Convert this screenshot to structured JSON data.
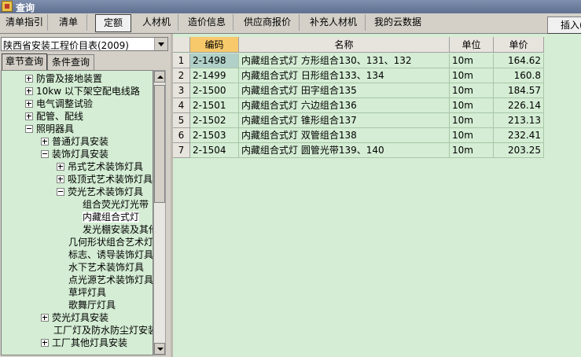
{
  "window": {
    "title": "查询"
  },
  "tabs": [
    {
      "label": "清单指引"
    },
    {
      "label": "清单"
    },
    {
      "label": "定额",
      "active": true
    },
    {
      "label": "人材机"
    },
    {
      "label": "造价信息"
    },
    {
      "label": "供应商报价"
    },
    {
      "label": "补充人材机"
    },
    {
      "label": "我的云数据"
    }
  ],
  "insert_button": "插入(I",
  "library": {
    "selected": "陕西省安装工程价目表(2009)"
  },
  "subtabs": [
    {
      "label": "章节查询",
      "active": true
    },
    {
      "label": "条件查询"
    }
  ],
  "tree": [
    {
      "label": "防雷及接地装置",
      "expander": "plus"
    },
    {
      "label": "10kw 以下架空配电线路",
      "expander": "plus"
    },
    {
      "label": "电气调整试验",
      "expander": "plus"
    },
    {
      "label": "配管、配线",
      "expander": "plus"
    },
    {
      "label": "照明器具",
      "expander": "minus"
    },
    {
      "label": "普通灯具安装",
      "expander": "plus"
    },
    {
      "label": "装饰灯具安装",
      "expander": "minus"
    },
    {
      "label": "吊式艺术装饰灯具",
      "expander": "plus"
    },
    {
      "label": "吸顶式艺术装饰灯具",
      "expander": "plus"
    },
    {
      "label": "荧光艺术装饰灯具",
      "expander": "minus"
    },
    {
      "label": "组合荧光灯光带",
      "expander": ""
    },
    {
      "label": "内藏组合式灯",
      "expander": "",
      "selected": true
    },
    {
      "label": "发光棚安装及其他",
      "expander": ""
    },
    {
      "label": "几何形状组合艺术灯具",
      "expander": ""
    },
    {
      "label": "标志、诱导装饰灯具",
      "expander": ""
    },
    {
      "label": "水下艺术装饰灯具",
      "expander": ""
    },
    {
      "label": "点光源艺术装饰灯具",
      "expander": ""
    },
    {
      "label": "草坪灯具",
      "expander": ""
    },
    {
      "label": "歌舞厅灯具",
      "expander": ""
    },
    {
      "label": "荧光灯具安装",
      "expander": "plus"
    },
    {
      "label": "工厂灯及防水防尘灯安装",
      "expander": ""
    },
    {
      "label": "工厂其他灯具安装",
      "expander": "plus"
    }
  ],
  "columns": {
    "code": "编码",
    "name": "名称",
    "unit": "单位",
    "price": "单价"
  },
  "rows": [
    {
      "num": "1",
      "code": "2-1498",
      "name": "内藏组合式灯 方形组合130、131、132",
      "unit": "10m",
      "price": "164.62"
    },
    {
      "num": "2",
      "code": "2-1499",
      "name": "内藏组合式灯 日形组合133、134",
      "unit": "10m",
      "price": "160.8"
    },
    {
      "num": "3",
      "code": "2-1500",
      "name": "内藏组合式灯 田字组合135",
      "unit": "10m",
      "price": "184.57"
    },
    {
      "num": "4",
      "code": "2-1501",
      "name": "内藏组合式灯 六边组合136",
      "unit": "10m",
      "price": "226.14"
    },
    {
      "num": "5",
      "code": "2-1502",
      "name": "内藏组合式灯 锥形组合137",
      "unit": "10m",
      "price": "213.13"
    },
    {
      "num": "6",
      "code": "2-1503",
      "name": "内藏组合式灯 双管组合138",
      "unit": "10m",
      "price": "232.41"
    },
    {
      "num": "7",
      "code": "2-1504",
      "name": "内藏组合式灯 圆管光带139、140",
      "unit": "10m",
      "price": "203.25"
    }
  ]
}
